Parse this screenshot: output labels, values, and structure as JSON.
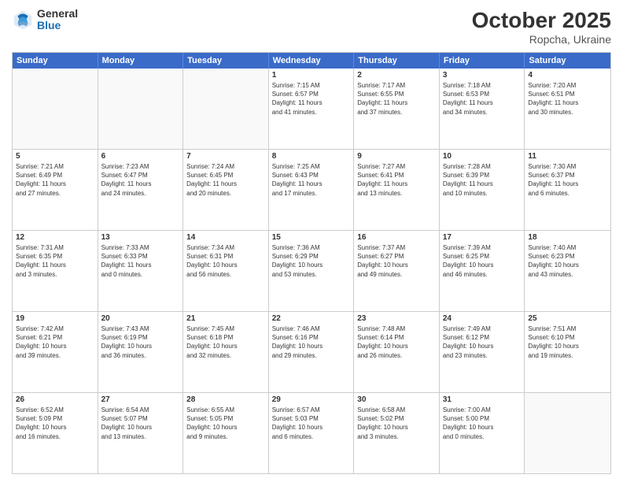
{
  "header": {
    "logo_general": "General",
    "logo_blue": "Blue",
    "month_title": "October 2025",
    "location": "Ropcha, Ukraine"
  },
  "days_of_week": [
    "Sunday",
    "Monday",
    "Tuesday",
    "Wednesday",
    "Thursday",
    "Friday",
    "Saturday"
  ],
  "weeks": [
    [
      {
        "day": "",
        "empty": true
      },
      {
        "day": "",
        "empty": true
      },
      {
        "day": "",
        "empty": true
      },
      {
        "day": "1",
        "lines": [
          "Sunrise: 7:15 AM",
          "Sunset: 6:57 PM",
          "Daylight: 11 hours",
          "and 41 minutes."
        ]
      },
      {
        "day": "2",
        "lines": [
          "Sunrise: 7:17 AM",
          "Sunset: 6:55 PM",
          "Daylight: 11 hours",
          "and 37 minutes."
        ]
      },
      {
        "day": "3",
        "lines": [
          "Sunrise: 7:18 AM",
          "Sunset: 6:53 PM",
          "Daylight: 11 hours",
          "and 34 minutes."
        ]
      },
      {
        "day": "4",
        "lines": [
          "Sunrise: 7:20 AM",
          "Sunset: 6:51 PM",
          "Daylight: 11 hours",
          "and 30 minutes."
        ]
      }
    ],
    [
      {
        "day": "5",
        "lines": [
          "Sunrise: 7:21 AM",
          "Sunset: 6:49 PM",
          "Daylight: 11 hours",
          "and 27 minutes."
        ]
      },
      {
        "day": "6",
        "lines": [
          "Sunrise: 7:23 AM",
          "Sunset: 6:47 PM",
          "Daylight: 11 hours",
          "and 24 minutes."
        ]
      },
      {
        "day": "7",
        "lines": [
          "Sunrise: 7:24 AM",
          "Sunset: 6:45 PM",
          "Daylight: 11 hours",
          "and 20 minutes."
        ]
      },
      {
        "day": "8",
        "lines": [
          "Sunrise: 7:25 AM",
          "Sunset: 6:43 PM",
          "Daylight: 11 hours",
          "and 17 minutes."
        ]
      },
      {
        "day": "9",
        "lines": [
          "Sunrise: 7:27 AM",
          "Sunset: 6:41 PM",
          "Daylight: 11 hours",
          "and 13 minutes."
        ]
      },
      {
        "day": "10",
        "lines": [
          "Sunrise: 7:28 AM",
          "Sunset: 6:39 PM",
          "Daylight: 11 hours",
          "and 10 minutes."
        ]
      },
      {
        "day": "11",
        "lines": [
          "Sunrise: 7:30 AM",
          "Sunset: 6:37 PM",
          "Daylight: 11 hours",
          "and 6 minutes."
        ]
      }
    ],
    [
      {
        "day": "12",
        "lines": [
          "Sunrise: 7:31 AM",
          "Sunset: 6:35 PM",
          "Daylight: 11 hours",
          "and 3 minutes."
        ]
      },
      {
        "day": "13",
        "lines": [
          "Sunrise: 7:33 AM",
          "Sunset: 6:33 PM",
          "Daylight: 11 hours",
          "and 0 minutes."
        ]
      },
      {
        "day": "14",
        "lines": [
          "Sunrise: 7:34 AM",
          "Sunset: 6:31 PM",
          "Daylight: 10 hours",
          "and 56 minutes."
        ]
      },
      {
        "day": "15",
        "lines": [
          "Sunrise: 7:36 AM",
          "Sunset: 6:29 PM",
          "Daylight: 10 hours",
          "and 53 minutes."
        ]
      },
      {
        "day": "16",
        "lines": [
          "Sunrise: 7:37 AM",
          "Sunset: 6:27 PM",
          "Daylight: 10 hours",
          "and 49 minutes."
        ]
      },
      {
        "day": "17",
        "lines": [
          "Sunrise: 7:39 AM",
          "Sunset: 6:25 PM",
          "Daylight: 10 hours",
          "and 46 minutes."
        ]
      },
      {
        "day": "18",
        "lines": [
          "Sunrise: 7:40 AM",
          "Sunset: 6:23 PM",
          "Daylight: 10 hours",
          "and 43 minutes."
        ]
      }
    ],
    [
      {
        "day": "19",
        "lines": [
          "Sunrise: 7:42 AM",
          "Sunset: 6:21 PM",
          "Daylight: 10 hours",
          "and 39 minutes."
        ]
      },
      {
        "day": "20",
        "lines": [
          "Sunrise: 7:43 AM",
          "Sunset: 6:19 PM",
          "Daylight: 10 hours",
          "and 36 minutes."
        ]
      },
      {
        "day": "21",
        "lines": [
          "Sunrise: 7:45 AM",
          "Sunset: 6:18 PM",
          "Daylight: 10 hours",
          "and 32 minutes."
        ]
      },
      {
        "day": "22",
        "lines": [
          "Sunrise: 7:46 AM",
          "Sunset: 6:16 PM",
          "Daylight: 10 hours",
          "and 29 minutes."
        ]
      },
      {
        "day": "23",
        "lines": [
          "Sunrise: 7:48 AM",
          "Sunset: 6:14 PM",
          "Daylight: 10 hours",
          "and 26 minutes."
        ]
      },
      {
        "day": "24",
        "lines": [
          "Sunrise: 7:49 AM",
          "Sunset: 6:12 PM",
          "Daylight: 10 hours",
          "and 23 minutes."
        ]
      },
      {
        "day": "25",
        "lines": [
          "Sunrise: 7:51 AM",
          "Sunset: 6:10 PM",
          "Daylight: 10 hours",
          "and 19 minutes."
        ]
      }
    ],
    [
      {
        "day": "26",
        "lines": [
          "Sunrise: 6:52 AM",
          "Sunset: 5:09 PM",
          "Daylight: 10 hours",
          "and 16 minutes."
        ]
      },
      {
        "day": "27",
        "lines": [
          "Sunrise: 6:54 AM",
          "Sunset: 5:07 PM",
          "Daylight: 10 hours",
          "and 13 minutes."
        ]
      },
      {
        "day": "28",
        "lines": [
          "Sunrise: 6:55 AM",
          "Sunset: 5:05 PM",
          "Daylight: 10 hours",
          "and 9 minutes."
        ]
      },
      {
        "day": "29",
        "lines": [
          "Sunrise: 6:57 AM",
          "Sunset: 5:03 PM",
          "Daylight: 10 hours",
          "and 6 minutes."
        ]
      },
      {
        "day": "30",
        "lines": [
          "Sunrise: 6:58 AM",
          "Sunset: 5:02 PM",
          "Daylight: 10 hours",
          "and 3 minutes."
        ]
      },
      {
        "day": "31",
        "lines": [
          "Sunrise: 7:00 AM",
          "Sunset: 5:00 PM",
          "Daylight: 10 hours",
          "and 0 minutes."
        ]
      },
      {
        "day": "",
        "empty": true
      }
    ]
  ]
}
